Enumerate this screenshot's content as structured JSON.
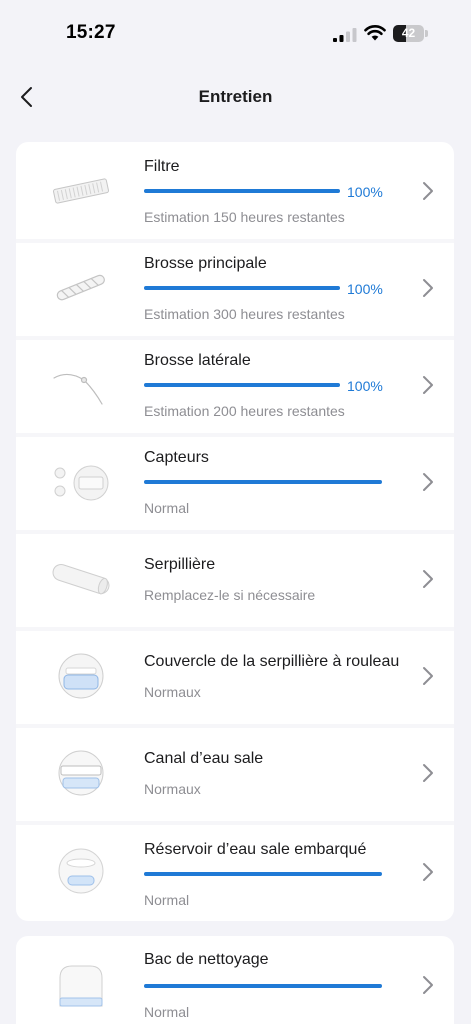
{
  "status_bar": {
    "time": "15:27",
    "battery": "42",
    "battery_level": 0.42
  },
  "nav": {
    "title": "Entretien"
  },
  "items": [
    {
      "name": "Filtre",
      "percent": "100%",
      "level": 1.0,
      "subtitle": "Estimation 150 heures restantes",
      "icon": "filter-icon"
    },
    {
      "name": "Brosse principale",
      "percent": "100%",
      "level": 1.0,
      "subtitle": "Estimation 300 heures restantes",
      "icon": "main-brush-icon"
    },
    {
      "name": "Brosse latérale",
      "percent": "100%",
      "level": 1.0,
      "subtitle": "Estimation 200 heures restantes",
      "icon": "side-brush-icon"
    },
    {
      "name": "Capteurs",
      "level": 1.0,
      "subtitle": "Normal",
      "icon": "sensors-icon"
    },
    {
      "name": "Serpillière",
      "subtitle": "Remplacez-le si nécessaire",
      "icon": "mop-roller-icon"
    },
    {
      "name": "Couvercle de la serpillière à rouleau",
      "subtitle": "Normaux",
      "icon": "mop-cover-icon"
    },
    {
      "name": "Canal d’eau sale",
      "subtitle": "Normaux",
      "icon": "dirty-water-channel-icon"
    },
    {
      "name": "Réservoir d’eau sale embarqué",
      "level": 1.0,
      "subtitle": "Normal",
      "icon": "onboard-dirty-water-tank-icon"
    },
    {
      "name": "Bac de nettoyage",
      "level": 1.0,
      "subtitle": "Normal",
      "icon": "cleaning-tray-icon"
    }
  ],
  "colors": {
    "accent": "#1f7ad6",
    "background": "#f3f3f8",
    "card": "#ffffff",
    "secondary_text": "#8e8e93"
  }
}
